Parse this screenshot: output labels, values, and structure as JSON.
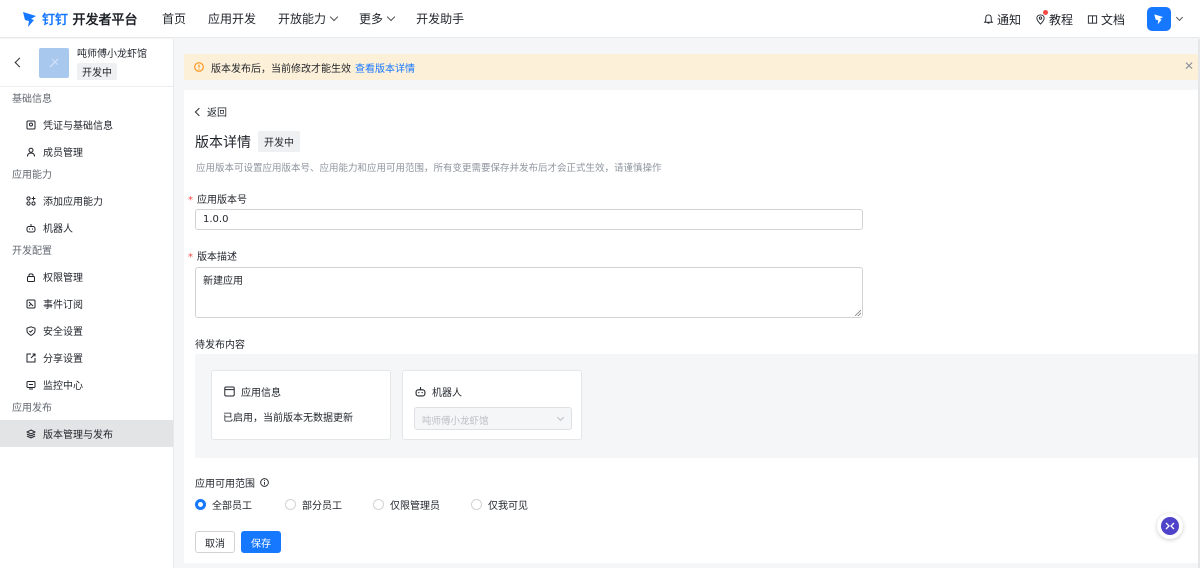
{
  "topbar": {
    "brand": "钉钉",
    "platform": "开发者平台",
    "nav": [
      {
        "label": "首页",
        "dropdown": false
      },
      {
        "label": "应用开发",
        "dropdown": false
      },
      {
        "label": "开放能力",
        "dropdown": true
      },
      {
        "label": "更多",
        "dropdown": true
      },
      {
        "label": "开发助手",
        "dropdown": false
      }
    ],
    "notify_label": "通知",
    "tutorial_label": "教程",
    "docs_label": "文档"
  },
  "sidebar": {
    "app_name": "吨师傅小龙虾馆",
    "app_status": "开发中",
    "groups": [
      {
        "title": "基础信息",
        "items": [
          {
            "label": "凭证与基础信息",
            "icon": "credential-icon"
          },
          {
            "label": "成员管理",
            "icon": "user-icon"
          }
        ]
      },
      {
        "title": "应用能力",
        "items": [
          {
            "label": "添加应用能力",
            "icon": "grid-add-icon"
          },
          {
            "label": "机器人",
            "icon": "robot-icon"
          }
        ]
      },
      {
        "title": "开发配置",
        "items": [
          {
            "label": "权限管理",
            "icon": "lock-icon"
          },
          {
            "label": "事件订阅",
            "icon": "event-icon"
          },
          {
            "label": "安全设置",
            "icon": "shield-icon"
          },
          {
            "label": "分享设置",
            "icon": "share-icon"
          },
          {
            "label": "监控中心",
            "icon": "monitor-icon"
          }
        ]
      },
      {
        "title": "应用发布",
        "items": [
          {
            "label": "版本管理与发布",
            "icon": "layers-icon",
            "active": true
          }
        ]
      }
    ]
  },
  "notice": {
    "text": "版本发布后，当前修改才能生效",
    "link": "查看版本详情"
  },
  "detail": {
    "back_label": "返回",
    "title": "版本详情",
    "status": "开发中",
    "description": "应用版本可设置应用版本号、应用能力和应用可用范围，所有变更需要保存并发布后才会正式生效，请谨慎操作",
    "version_label": "应用版本号",
    "version_value": "1.0.0",
    "desc_label": "版本描述",
    "desc_value": "新建应用",
    "pending_label": "待发布内容",
    "card_app_title": "应用信息",
    "card_app_text": "已启用，当前版本无数据更新",
    "card_robot_title": "机器人",
    "robot_select_value": "吨师傅小龙虾馆",
    "scope_label": "应用可用范围",
    "scope_options": [
      {
        "label": "全部员工",
        "selected": true
      },
      {
        "label": "部分员工",
        "selected": false
      },
      {
        "label": "仅限管理员",
        "selected": false
      },
      {
        "label": "仅我可见",
        "selected": false
      }
    ],
    "cancel_label": "取消",
    "save_label": "保存"
  },
  "colors": {
    "accent": "#1677ff",
    "notice_bg": "#fdf0d9",
    "warning": "#ff8800"
  }
}
